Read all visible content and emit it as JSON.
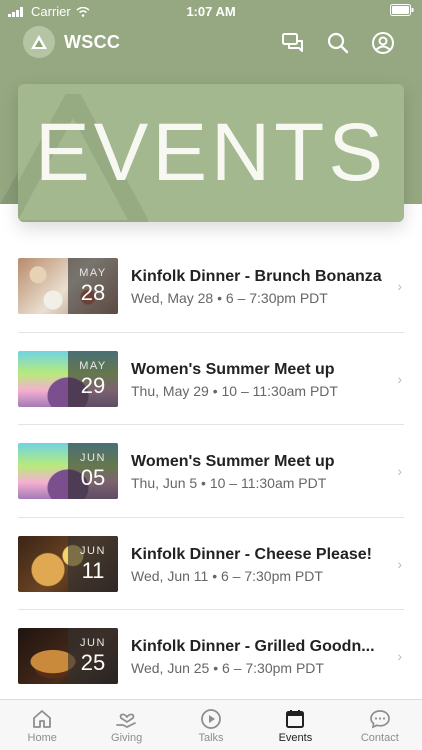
{
  "status": {
    "carrier": "Carrier",
    "time": "1:07 AM"
  },
  "header": {
    "brand": "WSCC",
    "hero_title": "EVENTS"
  },
  "events": [
    {
      "title": "Kinfolk Dinner - Brunch Bonanza",
      "subtitle": "Wed, May 28 • 6 – 7:30pm PDT",
      "month": "MAY",
      "day": "28"
    },
    {
      "title": "Women's Summer Meet up",
      "subtitle": "Thu, May 29 • 10 – 11:30am PDT",
      "month": "MAY",
      "day": "29"
    },
    {
      "title": "Women's Summer Meet up",
      "subtitle": "Thu, Jun 5 • 10 – 11:30am PDT",
      "month": "JUN",
      "day": "05"
    },
    {
      "title": "Kinfolk Dinner - Cheese Please!",
      "subtitle": "Wed, Jun 11 • 6 – 7:30pm PDT",
      "month": "JUN",
      "day": "11"
    },
    {
      "title": "Kinfolk Dinner - Grilled Goodn...",
      "subtitle": "Wed, Jun 25 • 6 – 7:30pm PDT",
      "month": "JUN",
      "day": "25"
    }
  ],
  "tabs": [
    {
      "label": "Home",
      "icon": "home-icon"
    },
    {
      "label": "Giving",
      "icon": "giving-icon"
    },
    {
      "label": "Talks",
      "icon": "play-icon"
    },
    {
      "label": "Events",
      "icon": "calendar-icon",
      "active": true
    },
    {
      "label": "Contact",
      "icon": "chat-icon"
    }
  ],
  "colors": {
    "header": "#96a882",
    "hero": "#a3b88e"
  }
}
